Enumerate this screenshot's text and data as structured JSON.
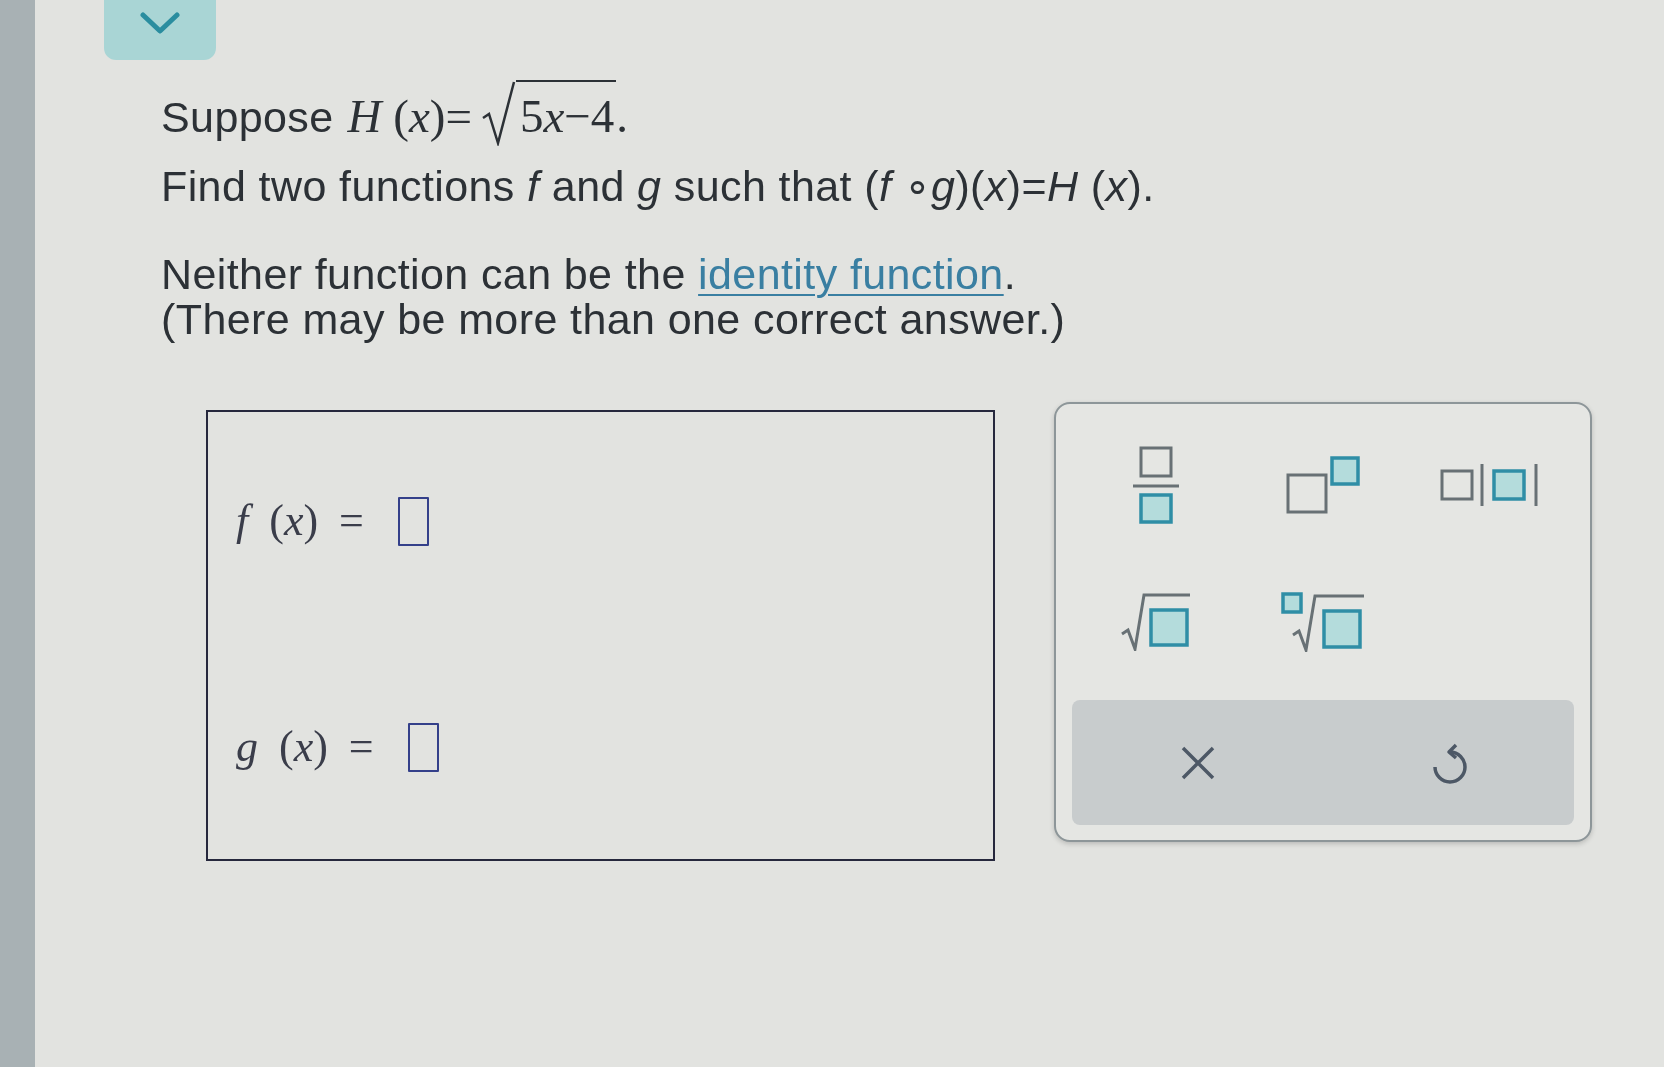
{
  "question": {
    "paragraphs": [
      {
        "lines": [
          {
            "kind": "formula",
            "segments": [
              {
                "kind": "text",
                "text": "Suppose"
              },
              {
                "kind": "math",
                "text": "*H* (*x*)="
              },
              {
                "kind": "sqrt",
                "parts": [
                  {
                    "kind": "number",
                    "text": "5"
                  },
                  {
                    "kind": "variable",
                    "text": "x"
                  },
                  {
                    "kind": "number",
                    "text": "−4"
                  }
                ]
              },
              {
                "kind": "math",
                "text": "."
              }
            ]
          },
          {
            "kind": "sentence",
            "text": "Find two functions *f* and *g* such that (*f* ∘*g*)(*x*)=*H* (*x*)."
          }
        ]
      },
      {
        "lines": [
          {
            "kind": "linked",
            "before": "Neither function can be the ",
            "link": "identity function",
            "after": "."
          },
          {
            "kind": "sentence",
            "text": "(There may be more than one correct answer.)"
          }
        ]
      }
    ]
  },
  "answers": [
    {
      "label": "*f* (*x*) ="
    },
    {
      "label": "*g* (*x*) ="
    }
  ]
}
